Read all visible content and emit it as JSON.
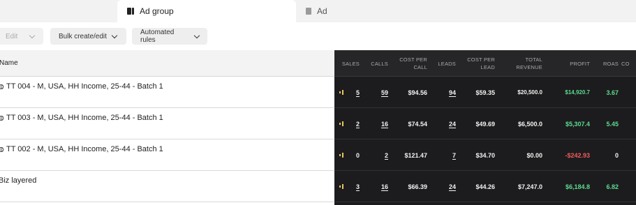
{
  "tabs": {
    "adgroup": "Ad group",
    "ad": "Ad"
  },
  "toolbar": {
    "edit": "Edit",
    "bulk": "Bulk create/edit",
    "automated": "Automated rules"
  },
  "table": {
    "name_header": "Name",
    "headers": {
      "sales": "SALES",
      "calls": "CALLS",
      "cost_per_call": "COST PER CALL",
      "leads": "LEADS",
      "cost_per_lead": "COST PER LEAD",
      "total_revenue": "TOTAL REVENUE",
      "profit": "PROFIT",
      "roas": "ROAS",
      "co": "CO"
    },
    "rows": [
      {
        "name": "TT 004 - M, USA, HH Income, 25-44 - Batch 1",
        "sales": "5",
        "calls": "59",
        "cost_per_call": "$94.56",
        "leads": "94",
        "cost_per_lead": "$59.35",
        "total_revenue": "$20,500.0",
        "profit": "$14,920.7",
        "roas": "3.67"
      },
      {
        "name": "TT 003 - M, USA, HH Income, 25-44 - Batch 1",
        "sales": "2",
        "calls": "16",
        "cost_per_call": "$74.54",
        "leads": "24",
        "cost_per_lead": "$49.69",
        "total_revenue": "$6,500.0",
        "profit": "$5,307.4",
        "roas": "5.45"
      },
      {
        "name": "TT 002 - M, USA, HH Income, 25-44 - Batch 1",
        "sales": "0",
        "calls": "2",
        "cost_per_call": "$121.47",
        "leads": "7",
        "cost_per_lead": "$34.70",
        "total_revenue": "$0.00",
        "profit": "-$242.93",
        "roas": "0"
      },
      {
        "name": "Biz layered",
        "sales": "3",
        "calls": "16",
        "cost_per_call": "$66.39",
        "leads": "24",
        "cost_per_lead": "$44.26",
        "total_revenue": "$7,247.0",
        "profit": "$6,184.8",
        "roas": "6.82"
      }
    ]
  },
  "colors": {
    "profit_positive": "#5ddb8f",
    "profit_negative": "#ef5b5b",
    "dark_panel": "#1c1c1e",
    "bar_icon": "#e8c65a"
  }
}
